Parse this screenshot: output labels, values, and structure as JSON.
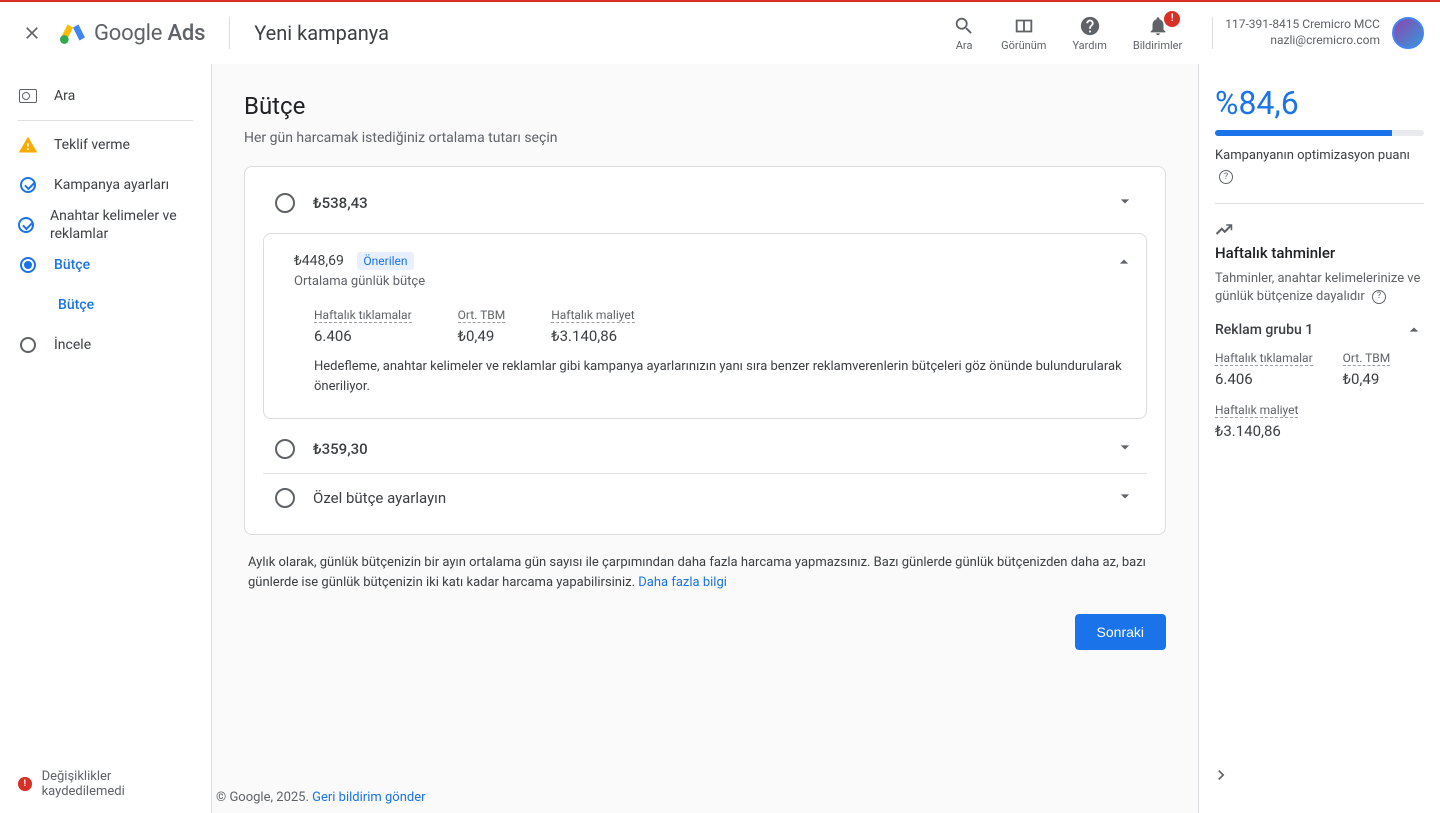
{
  "header": {
    "product_g": "Google",
    "product_a": " Ads",
    "page_title": "Yeni kampanya",
    "actions": {
      "search": "Ara",
      "appearance": "Görünüm",
      "help": "Yardım",
      "notifications": "Bildirimler"
    },
    "account_line1": "117-391-8415 Cremicro MCC",
    "account_line2": "nazli@cremicro.com"
  },
  "sidebar": {
    "search": "Ara",
    "bidding": "Teklif verme",
    "campaign_settings": "Kampanya ayarları",
    "keywords_ads": "Anahtar kelimeler ve reklamlar",
    "budget": "Bütçe",
    "budget_sub": "Bütçe",
    "review": "İncele",
    "unsaved": "Değişiklikler kaydedilemedi"
  },
  "main": {
    "title": "Bütçe",
    "subtitle": "Her gün harcamak istediğiniz ortalama tutarı seçin",
    "option1_price": "₺538,43",
    "option2_price": "₺448,69",
    "option2_recommended": "Önerilen",
    "option2_sub": "Ortalama günlük bütçe",
    "metrics": {
      "clicks_label": "Haftalık tıklamalar",
      "clicks_value": "6.406",
      "cpc_label": "Ort. TBM",
      "cpc_value": "₺0,49",
      "cost_label": "Haftalık maliyet",
      "cost_value": "₺3.140,86"
    },
    "option2_desc": "Hedefleme, anahtar kelimeler ve reklamlar gibi kampanya ayarlarınızın yanı sıra benzer reklamverenlerin bütçeleri göz önünde bulundurularak öneriliyor.",
    "option3_price": "₺359,30",
    "option4_label": "Özel bütçe ayarlayın",
    "footnote_text": "Aylık olarak, günlük bütçenizin bir ayın ortalama gün sayısı ile çarpımından daha fazla harcama yapmazsınız. Bazı günlerde günlük bütçenizden daha az, bazı günlerde ise günlük bütçenizin iki katı kadar harcama yapabilirsiniz. ",
    "footnote_link": "Daha fazla bilgi",
    "next": "Sonraki",
    "copyright": "© Google, 2025. ",
    "feedback": "Geri bildirim gönder"
  },
  "right": {
    "score": "%84,6",
    "score_label": "Kampanyanın optimizasyon puanı",
    "estimates_title": "Haftalık tahminler",
    "estimates_sub": "Tahminler, anahtar kelimelerinize ve günlük bütçenize dayalıdır",
    "adgroup": "Reklam grubu 1",
    "m_clicks_label": "Haftalık tıklamalar",
    "m_clicks_value": "6.406",
    "m_cpc_label": "Ort. TBM",
    "m_cpc_value": "₺0,49",
    "m_cost_label": "Haftalık maliyet",
    "m_cost_value": "₺3.140,86"
  }
}
